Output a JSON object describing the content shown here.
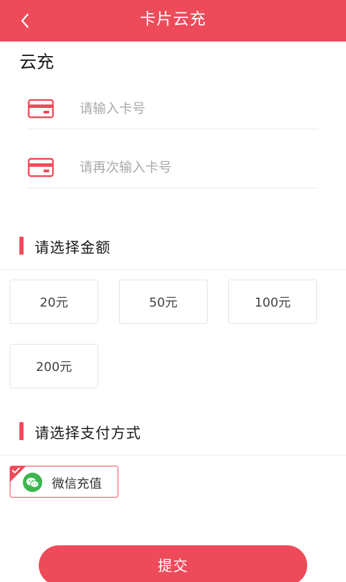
{
  "header": {
    "title": "卡片云充",
    "back_icon": "chevron-left-icon"
  },
  "section_label": "云充",
  "card_fields": [
    {
      "placeholder": "请输入卡号",
      "value": "",
      "icon": "credit-card-icon"
    },
    {
      "placeholder": "请再次输入卡号",
      "value": "",
      "icon": "credit-card-icon"
    }
  ],
  "amount_section": {
    "title": "请选择金额",
    "options": [
      "20元",
      "50元",
      "100元",
      "200元"
    ]
  },
  "payment_section": {
    "title": "请选择支付方式",
    "options": [
      {
        "label": "微信充值",
        "icon": "wechat-icon",
        "selected": true
      }
    ]
  },
  "submit_label": "提交",
  "colors": {
    "accent": "#ee4b5a",
    "wechat_green": "#3db64e"
  }
}
